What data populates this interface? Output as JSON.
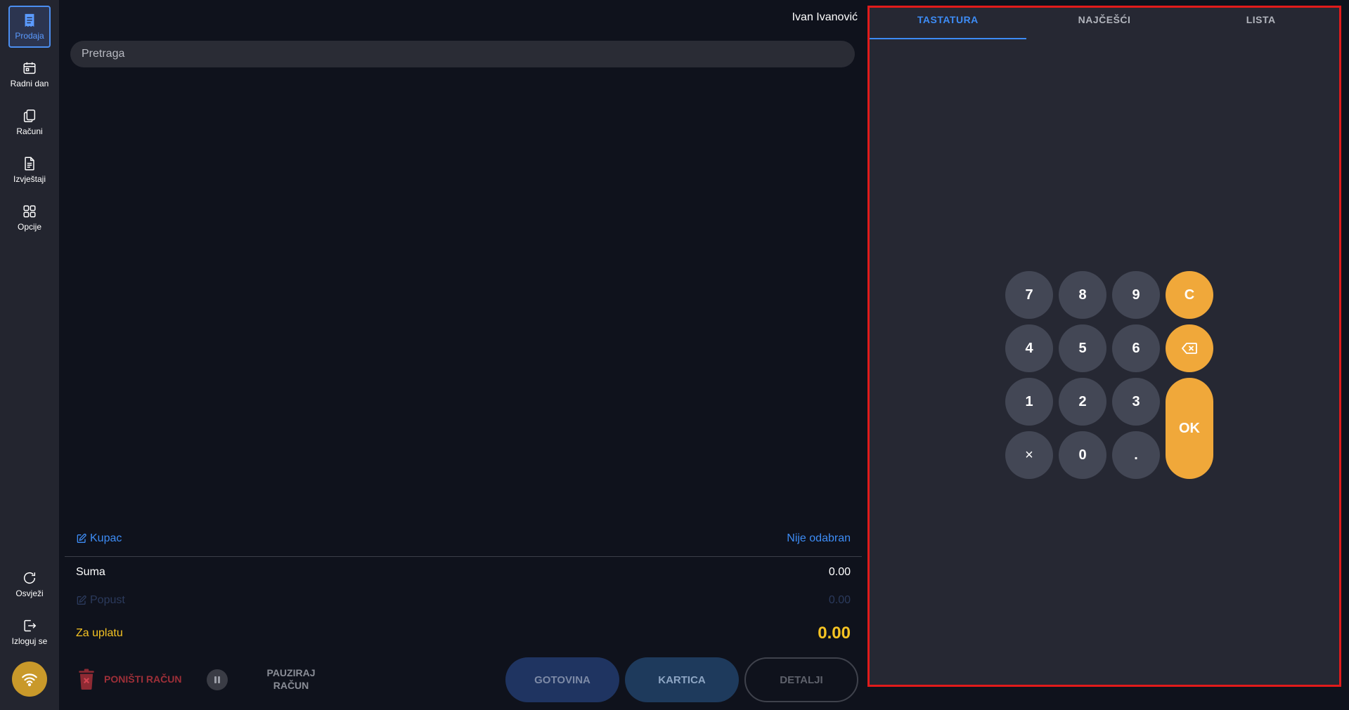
{
  "sidebar": {
    "items": [
      {
        "label": "Prodaja",
        "icon": "receipt-icon"
      },
      {
        "label": "Radni dan",
        "icon": "calendar-icon"
      },
      {
        "label": "Računi",
        "icon": "copy-icon"
      },
      {
        "label": "Izvještaji",
        "icon": "document-icon"
      },
      {
        "label": "Opcije",
        "icon": "grid-icon"
      }
    ],
    "bottom": [
      {
        "label": "Osvježi",
        "icon": "refresh-icon"
      },
      {
        "label": "Izloguj se",
        "icon": "logout-icon"
      }
    ],
    "status_icon": "wifi-icon"
  },
  "header": {
    "user_name": "Ivan Ivanović"
  },
  "search": {
    "placeholder": "Pretraga"
  },
  "summary": {
    "kupac_label": "Kupac",
    "kupac_value": "Nije odabran",
    "suma_label": "Suma",
    "suma_value": "0.00",
    "popust_label": "Popust",
    "popust_value": "0.00",
    "za_uplatu_label": "Za uplatu",
    "za_uplatu_value": "0.00"
  },
  "actions": {
    "ponisti_label": "PONIŠTI RAČUN",
    "pauziraj_line1": "PAUZIRAJ",
    "pauziraj_line2": "RAČUN",
    "gotovina_label": "GOTOVINA",
    "kartica_label": "KARTICA",
    "detalji_label": "DETALJI"
  },
  "panel": {
    "tabs": [
      "TASTATURA",
      "NAJČEŠĆI",
      "LISTA"
    ],
    "active_tab": "TASTATURA",
    "keys": {
      "k7": "7",
      "k8": "8",
      "k9": "9",
      "kc": "C",
      "k4": "4",
      "k5": "5",
      "k6": "6",
      "k1": "1",
      "k2": "2",
      "k3": "3",
      "kok": "OK",
      "kx": "×",
      "k0": "0",
      "kdot": "."
    }
  },
  "colors": {
    "accent": "#3d8cf5",
    "orange": "#f0a83a",
    "total": "#f5c323",
    "highlight_border": "#e11b1b"
  }
}
